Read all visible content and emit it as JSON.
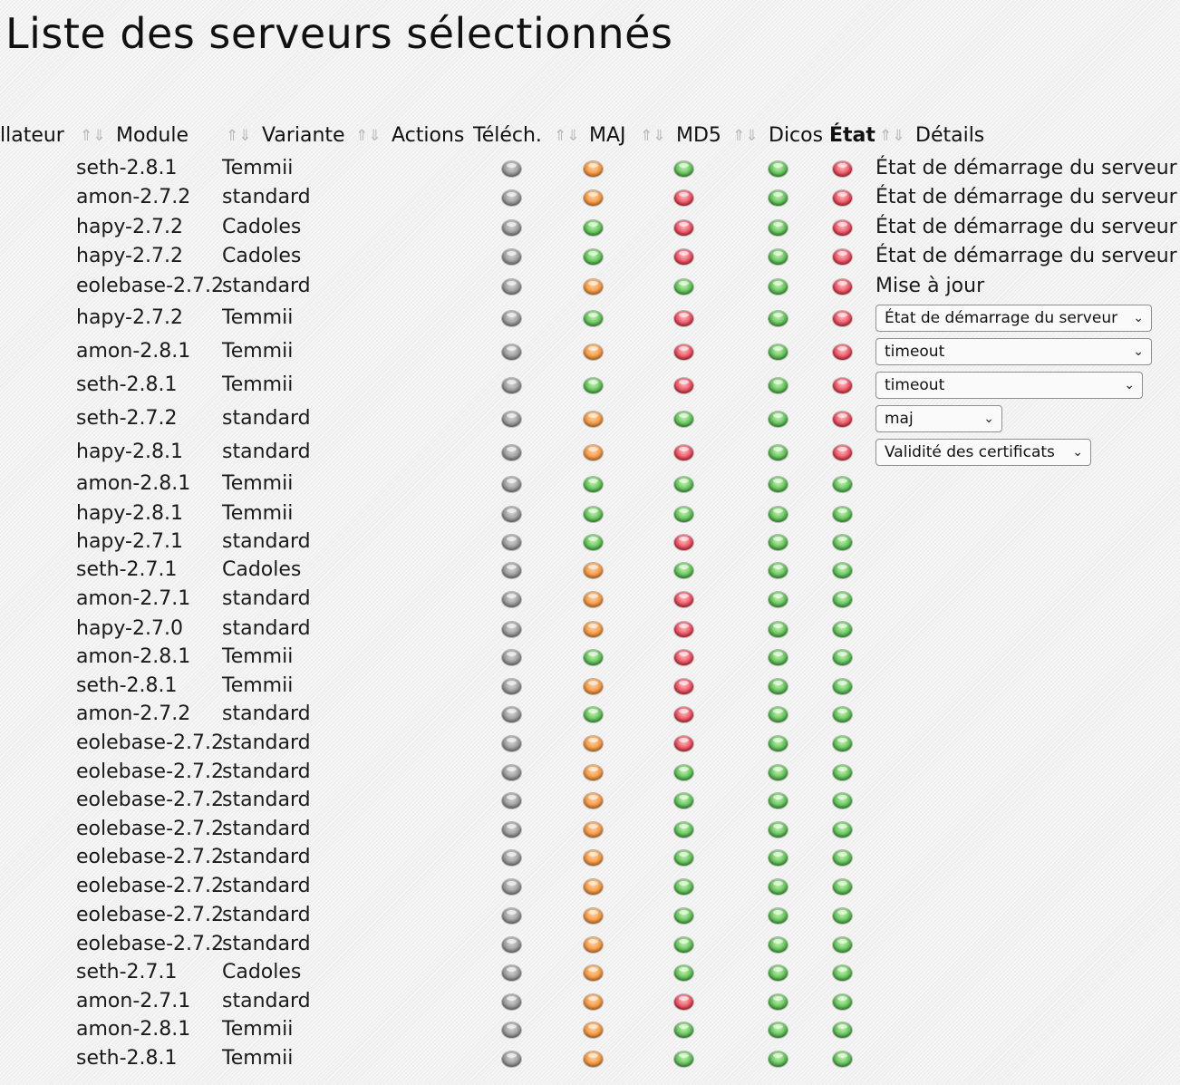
{
  "page": {
    "title": "Liste des serveurs sélectionnés"
  },
  "table": {
    "headers": {
      "installateur": "llateur",
      "module": "Module",
      "variante": "Variante",
      "actions": "Actions",
      "telech": "Téléch.",
      "maj": "MAJ",
      "md5": "MD5",
      "dicos": "Dicos",
      "etat": "État",
      "details": "Détails"
    },
    "sort_arrows_label": "⇑⇓",
    "status_colors": {
      "gray": "#a0a0a0",
      "orange": "#f5a04b",
      "green": "#5cc44e",
      "red": "#ee4455"
    },
    "rows": [
      {
        "module": "seth-2.8.1",
        "variante": "Temmii",
        "telech": "gray",
        "maj": "orange",
        "md5": "green",
        "dicos": "green",
        "etat": "red",
        "details": {
          "type": "text",
          "value": "État de démarrage du serveur"
        }
      },
      {
        "module": "amon-2.7.2",
        "variante": "standard",
        "telech": "gray",
        "maj": "orange",
        "md5": "red",
        "dicos": "green",
        "etat": "red",
        "details": {
          "type": "text",
          "value": "État de démarrage du serveur"
        }
      },
      {
        "module": "hapy-2.7.2",
        "variante": "Cadoles",
        "telech": "gray",
        "maj": "green",
        "md5": "red",
        "dicos": "green",
        "etat": "red",
        "details": {
          "type": "text",
          "value": "État de démarrage du serveur"
        }
      },
      {
        "module": "hapy-2.7.2",
        "variante": "Cadoles",
        "telech": "gray",
        "maj": "green",
        "md5": "red",
        "dicos": "green",
        "etat": "red",
        "details": {
          "type": "text",
          "value": "État de démarrage du serveur"
        }
      },
      {
        "module": "eolebase-2.7.2",
        "variante": "standard",
        "telech": "gray",
        "maj": "orange",
        "md5": "green",
        "dicos": "green",
        "etat": "red",
        "details": {
          "type": "text",
          "value": "Mise à jour"
        }
      },
      {
        "module": "hapy-2.7.2",
        "variante": "Temmii",
        "telech": "gray",
        "maj": "green",
        "md5": "red",
        "dicos": "green",
        "etat": "red",
        "details": {
          "type": "select",
          "value": "État de démarrage du serveur"
        }
      },
      {
        "module": "amon-2.8.1",
        "variante": "Temmii",
        "telech": "gray",
        "maj": "orange",
        "md5": "red",
        "dicos": "green",
        "etat": "red",
        "details": {
          "type": "select",
          "value": "timeout"
        }
      },
      {
        "module": "seth-2.8.1",
        "variante": "Temmii",
        "telech": "gray",
        "maj": "green",
        "md5": "red",
        "dicos": "green",
        "etat": "red",
        "details": {
          "type": "select",
          "value": "timeout"
        }
      },
      {
        "module": "seth-2.7.2",
        "variante": "standard",
        "telech": "gray",
        "maj": "orange",
        "md5": "green",
        "dicos": "green",
        "etat": "red",
        "details": {
          "type": "select",
          "value": "maj"
        }
      },
      {
        "module": "hapy-2.8.1",
        "variante": "standard",
        "telech": "gray",
        "maj": "orange",
        "md5": "red",
        "dicos": "green",
        "etat": "red",
        "details": {
          "type": "select",
          "value": "Validité des certificats"
        }
      },
      {
        "module": "amon-2.8.1",
        "variante": "Temmii",
        "telech": "gray",
        "maj": "green",
        "md5": "green",
        "dicos": "green",
        "etat": "green",
        "details": null
      },
      {
        "module": "hapy-2.8.1",
        "variante": "Temmii",
        "telech": "gray",
        "maj": "green",
        "md5": "green",
        "dicos": "green",
        "etat": "green",
        "details": null
      },
      {
        "module": "hapy-2.7.1",
        "variante": "standard",
        "telech": "gray",
        "maj": "green",
        "md5": "red",
        "dicos": "green",
        "etat": "green",
        "details": null
      },
      {
        "module": "seth-2.7.1",
        "variante": "Cadoles",
        "telech": "gray",
        "maj": "orange",
        "md5": "green",
        "dicos": "green",
        "etat": "green",
        "details": null
      },
      {
        "module": "amon-2.7.1",
        "variante": "standard",
        "telech": "gray",
        "maj": "orange",
        "md5": "red",
        "dicos": "green",
        "etat": "green",
        "details": null
      },
      {
        "module": "hapy-2.7.0",
        "variante": "standard",
        "telech": "gray",
        "maj": "orange",
        "md5": "red",
        "dicos": "green",
        "etat": "green",
        "details": null
      },
      {
        "module": "amon-2.8.1",
        "variante": "Temmii",
        "telech": "gray",
        "maj": "green",
        "md5": "red",
        "dicos": "green",
        "etat": "green",
        "details": null
      },
      {
        "module": "seth-2.8.1",
        "variante": "Temmii",
        "telech": "gray",
        "maj": "orange",
        "md5": "red",
        "dicos": "green",
        "etat": "green",
        "details": null
      },
      {
        "module": "amon-2.7.2",
        "variante": "standard",
        "telech": "gray",
        "maj": "green",
        "md5": "red",
        "dicos": "green",
        "etat": "green",
        "details": null
      },
      {
        "module": "eolebase-2.7.2",
        "variante": "standard",
        "telech": "gray",
        "maj": "orange",
        "md5": "red",
        "dicos": "green",
        "etat": "green",
        "details": null
      },
      {
        "module": "eolebase-2.7.2",
        "variante": "standard",
        "telech": "gray",
        "maj": "orange",
        "md5": "green",
        "dicos": "green",
        "etat": "green",
        "details": null
      },
      {
        "module": "eolebase-2.7.2",
        "variante": "standard",
        "telech": "gray",
        "maj": "orange",
        "md5": "green",
        "dicos": "green",
        "etat": "green",
        "details": null
      },
      {
        "module": "eolebase-2.7.2",
        "variante": "standard",
        "telech": "gray",
        "maj": "orange",
        "md5": "green",
        "dicos": "green",
        "etat": "green",
        "details": null
      },
      {
        "module": "eolebase-2.7.2",
        "variante": "standard",
        "telech": "gray",
        "maj": "orange",
        "md5": "green",
        "dicos": "green",
        "etat": "green",
        "details": null
      },
      {
        "module": "eolebase-2.7.2",
        "variante": "standard",
        "telech": "gray",
        "maj": "orange",
        "md5": "green",
        "dicos": "green",
        "etat": "green",
        "details": null
      },
      {
        "module": "eolebase-2.7.2",
        "variante": "standard",
        "telech": "gray",
        "maj": "orange",
        "md5": "green",
        "dicos": "green",
        "etat": "green",
        "details": null
      },
      {
        "module": "eolebase-2.7.2",
        "variante": "standard",
        "telech": "gray",
        "maj": "orange",
        "md5": "green",
        "dicos": "green",
        "etat": "green",
        "details": null
      },
      {
        "module": "seth-2.7.1",
        "variante": "Cadoles",
        "telech": "gray",
        "maj": "orange",
        "md5": "green",
        "dicos": "green",
        "etat": "green",
        "details": null
      },
      {
        "module": "amon-2.7.1",
        "variante": "standard",
        "telech": "gray",
        "maj": "orange",
        "md5": "red",
        "dicos": "green",
        "etat": "green",
        "details": null
      },
      {
        "module": "amon-2.8.1",
        "variante": "Temmii",
        "telech": "gray",
        "maj": "orange",
        "md5": "green",
        "dicos": "green",
        "etat": "green",
        "details": null
      },
      {
        "module": "seth-2.8.1",
        "variante": "Temmii",
        "telech": "gray",
        "maj": "orange",
        "md5": "green",
        "dicos": "green",
        "etat": "green",
        "details": null
      }
    ]
  }
}
